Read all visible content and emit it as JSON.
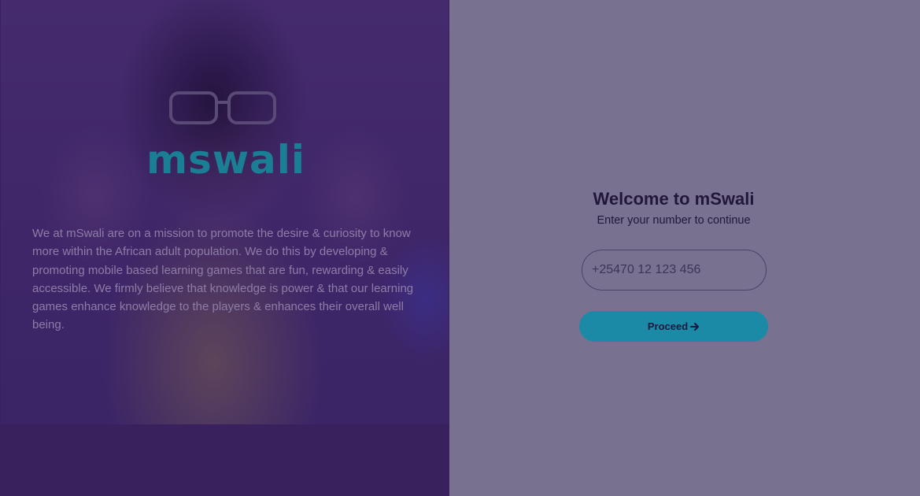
{
  "brand": {
    "logo_text": "mswali",
    "logo_color": "#1a7e95"
  },
  "hero": {
    "mission_text": "We at mSwali are on a mission to promote the desire & curiosity to know more within the African adult population. We do this by developing & promoting mobile based learning games that are fun, rewarding & easily accessible. We firmly believe that knowledge is power & that our learning games enhance knowledge to the players & enhances their overall well being."
  },
  "login": {
    "title": "Welcome to mSwali",
    "subtitle": "Enter your number to continue",
    "phone_placeholder": "+25470 12 123 456",
    "phone_value": "",
    "proceed_label": "Proceed",
    "proceed_icon": "arrow-right-icon"
  },
  "colors": {
    "left_panel": "#38215c",
    "right_panel": "#78718f",
    "accent": "#1a8aa6",
    "title_text": "#22173a"
  }
}
